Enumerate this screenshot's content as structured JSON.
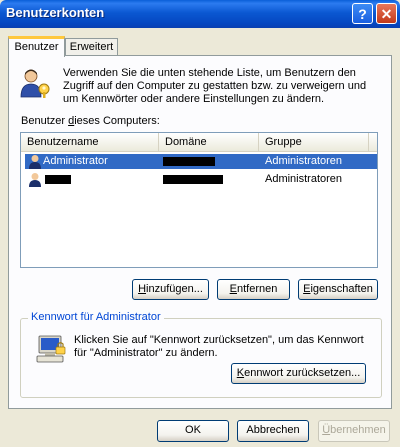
{
  "window": {
    "title": "Benutzerkonten"
  },
  "titlebar": {
    "help": "?",
    "close": "✕"
  },
  "tabs": [
    {
      "label": "Benutzer"
    },
    {
      "label": "Erweitert"
    }
  ],
  "intro_text": "Verwenden Sie die unten stehende Liste, um Benutzern den Zugriff auf den Computer zu gestatten bzw. zu verweigern und um Kennwörter oder andere Einstellungen zu ändern.",
  "users_label": "Benutzer dieses Computers:",
  "columns": [
    "Benutzername",
    "Domäne",
    "Gruppe"
  ],
  "users": [
    {
      "name": "Administrator",
      "group": "Administratoren",
      "selected": true
    },
    {
      "name": "",
      "group": "Administratoren",
      "selected": false
    }
  ],
  "buttons": {
    "add": "Hinzufügen...",
    "remove": "Entfernen",
    "properties": "Eigenschaften"
  },
  "password_group": {
    "title": "Kennwort für Administrator",
    "text": "Klicken Sie auf \"Kennwort zurücksetzen\", um das Kennwort für \"Administrator\" zu ändern.",
    "reset": "Kennwort zurücksetzen..."
  },
  "dialog_buttons": {
    "ok": "OK",
    "cancel": "Abbrechen",
    "apply": "Übernehmen"
  },
  "colors": {
    "title_bar": "#0a5fd8",
    "selection": "#316ac5",
    "group_title": "#0046d5"
  },
  "icons": [
    "users-key-icon",
    "user-icon",
    "computer-icon"
  ]
}
